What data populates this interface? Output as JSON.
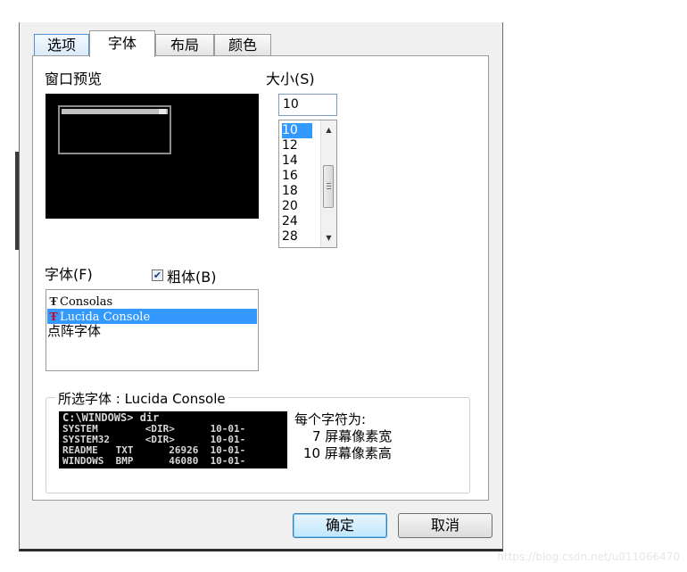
{
  "tabs": [
    {
      "label": "选项"
    },
    {
      "label": "字体"
    },
    {
      "label": "布局"
    },
    {
      "label": "颜色"
    }
  ],
  "preview": {
    "label": "窗口预览"
  },
  "size": {
    "label": "大小(S)",
    "value": "10",
    "options": [
      "10",
      "12",
      "14",
      "16",
      "18",
      "20",
      "24",
      "28"
    ],
    "selected": "10"
  },
  "font": {
    "label": "字体(F)",
    "bold_label": "粗体(B)",
    "bold_checked": true,
    "items": [
      {
        "name": "Consolas",
        "icon": "truetype-icon"
      },
      {
        "name": "Lucida Console",
        "icon": "truetype-icon"
      },
      {
        "name": "点阵字体",
        "icon": ""
      }
    ],
    "selected": "Lucida Console"
  },
  "selected_font": {
    "title": "所选字体 : Lucida Console",
    "sample_lines": [
      "C:\\WINDOWS> dir",
      "SYSTEM        <DIR>      10-01-",
      "SYSTEM32      <DIR>      10-01-",
      "README   TXT      26926  10-01-",
      "WINDOWS  BMP      46080  10-01-"
    ],
    "metrics_heading": "每个字符为:",
    "width_line": "7 屏幕像素宽",
    "height_line": "10 屏幕像素高"
  },
  "buttons": {
    "ok": "确定",
    "cancel": "取消"
  },
  "watermark": "https://blog.csdn.net/u011066470"
}
